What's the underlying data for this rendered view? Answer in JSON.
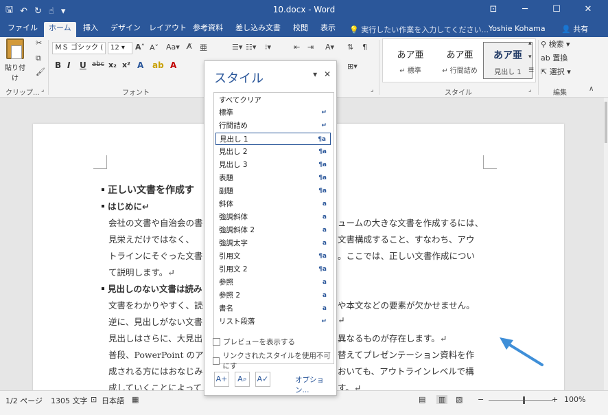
{
  "window": {
    "title": "10.docx - Word",
    "qat_icons": [
      "save-icon",
      "undo-icon",
      "redo-icon",
      "touch-mode-icon",
      "customize-icon"
    ],
    "controls": [
      "ribbon-display-icon",
      "minimize-icon",
      "maximize-icon",
      "close-icon"
    ]
  },
  "tabs": [
    "ファイル",
    "ホーム",
    "挿入",
    "デザイン",
    "レイアウト",
    "参考資料",
    "差し込み文書",
    "校閲",
    "表示"
  ],
  "active_tab": "ホーム",
  "tellme": "実行したい作業を入力してください...",
  "user": "Yoshie Kohama",
  "share": "共有",
  "ribbon": {
    "clipboard": {
      "paste_label": "貼り付け",
      "group": "クリップ..."
    },
    "font": {
      "name": "ＭＳ ゴシック (",
      "size": "12",
      "group": "フォント"
    },
    "style_gallery": [
      {
        "sample": "あア亜",
        "name": "↵ 標準"
      },
      {
        "sample": "あア亜",
        "name": "↵ 行間詰め"
      },
      {
        "sample": "あア亜",
        "name": "見出し 1"
      }
    ],
    "style_group": "スタイル",
    "editing": {
      "find": "検索",
      "replace": "置換",
      "select": "選択",
      "group": "編集"
    }
  },
  "styles_pane": {
    "title": "スタイル",
    "items": [
      {
        "name": "すべてクリア",
        "icon": ""
      },
      {
        "name": "標準",
        "icon": "↵"
      },
      {
        "name": "行間詰め",
        "icon": "↵"
      },
      {
        "name": "見出し 1",
        "icon": "¶a"
      },
      {
        "name": "見出し 2",
        "icon": "¶a"
      },
      {
        "name": "見出し 3",
        "icon": "¶a"
      },
      {
        "name": "表題",
        "icon": "¶a"
      },
      {
        "name": "副題",
        "icon": "¶a"
      },
      {
        "name": "斜体",
        "icon": "a"
      },
      {
        "name": "強調斜体",
        "icon": "a"
      },
      {
        "name": "強調斜体 2",
        "icon": "a"
      },
      {
        "name": "強調太字",
        "icon": "a"
      },
      {
        "name": "引用文",
        "icon": "¶a"
      },
      {
        "name": "引用文 2",
        "icon": "¶a"
      },
      {
        "name": "参照",
        "icon": "a"
      },
      {
        "name": "参照 2",
        "icon": "a"
      },
      {
        "name": "書名",
        "icon": "a"
      },
      {
        "name": "リスト段落",
        "icon": "↵"
      }
    ],
    "selected_index": 3,
    "preview_label": "プレビューを表示する",
    "linked_label": "リンクされたスタイルを使用不可にす",
    "options_label": "オプション..."
  },
  "document": {
    "lines": [
      {
        "text": "正しい文書を作成す",
        "type": "heading-big",
        "bullet": true
      },
      {
        "text": "はじめに↵",
        "type": "heading",
        "bullet": true
      },
      {
        "text": "会社の文書や自治会の書",
        "tail": "ュームの大きな文書を作成するには、",
        "type": "body"
      },
      {
        "text": "見栄えだけではなく、",
        "tail": "文書構成すること、すなわち、アウ",
        "type": "body"
      },
      {
        "text": "トラインにそぐった文書",
        "tail": "。ここでは、正しい文書作成につい",
        "type": "body"
      },
      {
        "text": "て説明します。↵",
        "tail": "",
        "type": "body"
      },
      {
        "text": "見出しのない文書は読み",
        "type": "heading",
        "bullet": true
      },
      {
        "text": "文書をわかりやすく、読",
        "tail": "や本文などの要素が欠かせません。",
        "type": "body"
      },
      {
        "text": "逆に、見出しがない文書",
        "tail": "↵",
        "type": "body"
      },
      {
        "text": "見出しはさらに、大見出",
        "tail": "異なるものが存在します。↵",
        "type": "body"
      },
      {
        "text": "普段、PowerPoint のア",
        "tail": "替えてプレゼンテーション資料を作",
        "type": "body"
      },
      {
        "text": "成される方にはおなじみ",
        "tail": "おいても、アウトラインレベルで構",
        "type": "body"
      },
      {
        "text": "成していくことによって",
        "tail": "す。↵",
        "type": "body"
      }
    ]
  },
  "status": {
    "page": "1/2 ページ",
    "words": "1305 文字",
    "language": "日本語",
    "zoom": "100%",
    "zoom_value": 100
  }
}
